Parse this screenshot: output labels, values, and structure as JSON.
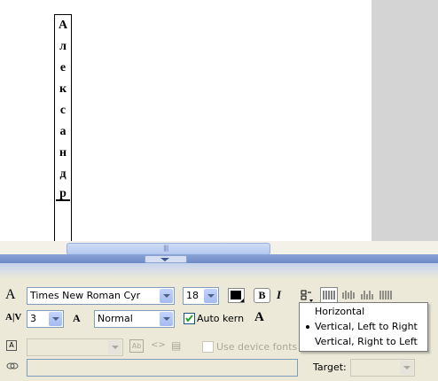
{
  "stage": {
    "vertical_text": [
      "А",
      "л",
      "е",
      "к",
      "с",
      "а",
      "н",
      "д",
      "р"
    ]
  },
  "properties": {
    "font_family": "Times New Roman Cyr",
    "font_size": "18",
    "bold_label": "B",
    "italic_label": "I",
    "char_spacing": "3",
    "char_position": "Normal",
    "auto_kern_label": "Auto kern",
    "auto_kern_checked": true,
    "use_device_fonts_label": "Use device fonts",
    "target_label": "Target:",
    "text_color": "#000000",
    "text_tool_glyph": "A",
    "spacing_glyph": "A|V",
    "position_glyph": "A",
    "format_glyph": "A",
    "selectable_glyph": "Ab",
    "html_glyph": "<>",
    "border_glyph": "▤"
  },
  "orientation_menu": {
    "items": [
      {
        "label": "Horizontal",
        "selected": false
      },
      {
        "label": "Vertical, Left to Right",
        "selected": true
      },
      {
        "label": "Vertical, Right to Left",
        "selected": false
      }
    ]
  },
  "colors": {
    "stage_bg": "#ffffff",
    "panel_bg": "#ece9d8",
    "splitter": "#7b93cc",
    "field_border": "#7f9db9",
    "dropdown_button": "#b4c8f0"
  }
}
